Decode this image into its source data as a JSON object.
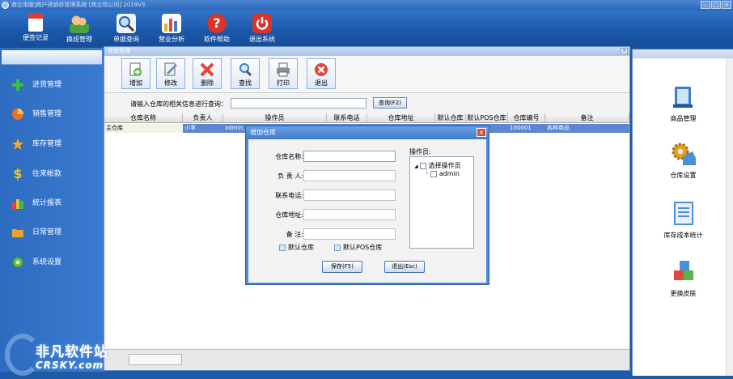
{
  "app": {
    "title": "商企用版|商户进销存管理系统 [商企用公司] 2019V3"
  },
  "topbar": {
    "buttons": [
      {
        "label": "便签记录",
        "icon": "notepad-icon",
        "color": "#e23b2e"
      },
      {
        "label": "换班管理",
        "icon": "people-icon",
        "color": "#4aa33c"
      },
      {
        "label": "单据查询",
        "icon": "magnifier-icon",
        "color": "#f0f4fa"
      },
      {
        "label": "营业分析",
        "icon": "bar-chart-icon",
        "color": "#f2a832"
      },
      {
        "label": "软件帮助",
        "icon": "help-icon",
        "color": "#d8342a"
      },
      {
        "label": "退出系统",
        "icon": "power-icon",
        "color": "#d9342b"
      }
    ]
  },
  "sidebar": {
    "items": [
      {
        "label": "进货管理",
        "icon": "plus-icon",
        "color": "#3fbf3f"
      },
      {
        "label": "销售管理",
        "icon": "pie-chart-icon",
        "color": "#e8732e"
      },
      {
        "label": "库存管理",
        "icon": "star-icon",
        "color": "#f5a623"
      },
      {
        "label": "往来帐款",
        "icon": "dollar-icon",
        "color": "#f4c11f"
      },
      {
        "label": "统计报表",
        "icon": "bar-chart-icon",
        "color": "#e0493c"
      },
      {
        "label": "日常管理",
        "icon": "folder-icon",
        "color": "#f0a02a"
      },
      {
        "label": "系统设置",
        "icon": "gear-icon",
        "color": "#6cc23a"
      }
    ]
  },
  "watermark": {
    "line1": "非凡软件站",
    "line2": "CRSKY.com"
  },
  "main": {
    "title": "仓库管理",
    "toolbar": [
      {
        "label": "增加",
        "icon": "add-doc-icon",
        "color": "#56b64a"
      },
      {
        "label": "修改",
        "icon": "edit-icon",
        "color": "#6f8fb7"
      },
      {
        "label": "删除",
        "icon": "delete-icon",
        "color": "#e0473b"
      },
      {
        "label": "查找",
        "icon": "search-icon",
        "color": "#6aa8e0"
      },
      {
        "label": "打印",
        "icon": "printer-icon",
        "color": "#8a8f98"
      },
      {
        "label": "退出",
        "icon": "exit-icon",
        "color": "#e0473b"
      }
    ],
    "query": {
      "label": "请输入仓库的相关信息进行查询：",
      "value": "",
      "button": "查询(F2)"
    },
    "table": {
      "columns": [
        "仓库名称",
        "负责人",
        "操作员",
        "联系电话",
        "仓库地址",
        "默认仓库",
        "默认POS仓库",
        "仓库编号",
        "备注"
      ],
      "rows": [
        [
          "主仓库",
          "小李",
          "admin,",
          "",
          "",
          "",
          "",
          "100001",
          "各种商品"
        ]
      ]
    }
  },
  "rightpanel": {
    "items": [
      {
        "label": "商品管理",
        "icon": "book-icon",
        "color": "#3d7ec9"
      },
      {
        "label": "仓库设置",
        "icon": "warehouse-gear-icon",
        "color": "#e2a12d"
      },
      {
        "label": "库存成本统计",
        "icon": "report-icon",
        "color": "#4b8fd6"
      },
      {
        "label": "更换皮肤",
        "icon": "cubes-icon",
        "color": "#e04a3c"
      }
    ]
  },
  "dialog": {
    "title": "增加仓库",
    "fields": [
      {
        "label": "仓库名称:",
        "value": ""
      },
      {
        "label": "负 责 人:",
        "value": ""
      },
      {
        "label": "联系电话:",
        "value": ""
      },
      {
        "label": "仓库地址:",
        "value": ""
      },
      {
        "label": "备    注:",
        "value": ""
      }
    ],
    "operators_label": "操作员:",
    "tree_root": "选择操作员",
    "tree_child": "admin",
    "checkbox_default": "默认仓库",
    "checkbox_pos": "默认POS仓库",
    "save_button": "保存(F5)",
    "exit_button": "退出(Esc)"
  }
}
